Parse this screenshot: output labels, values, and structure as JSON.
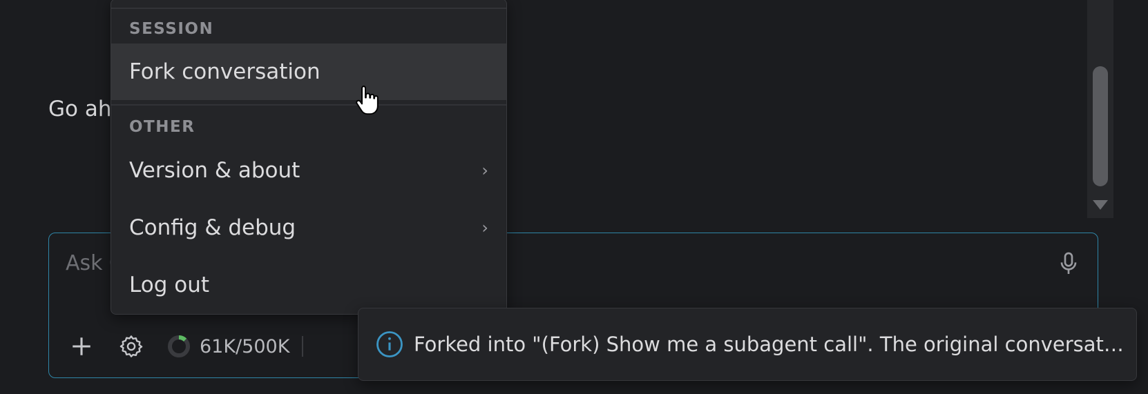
{
  "chat": {
    "message_fragment": "Go ahe"
  },
  "composer": {
    "placeholder": "Ask C",
    "token_usage": "61K/500K",
    "token_fraction": 0.122
  },
  "menu": {
    "sections": [
      {
        "header": "SESSION",
        "items": [
          {
            "label": "Fork conversation"
          }
        ]
      },
      {
        "header": "OTHER",
        "items": [
          {
            "label": "Version & about",
            "chevron": "›"
          },
          {
            "label": "Config & debug",
            "chevron": "›"
          },
          {
            "label": "Log out"
          }
        ]
      }
    ]
  },
  "toast": {
    "icon": "info-icon",
    "message": "Forked into \"(Fork) Show me a subagent call\". The original conversatio..."
  },
  "colors": {
    "accent": "#2f86a8",
    "token_ring_fill": "#5dbb63"
  }
}
